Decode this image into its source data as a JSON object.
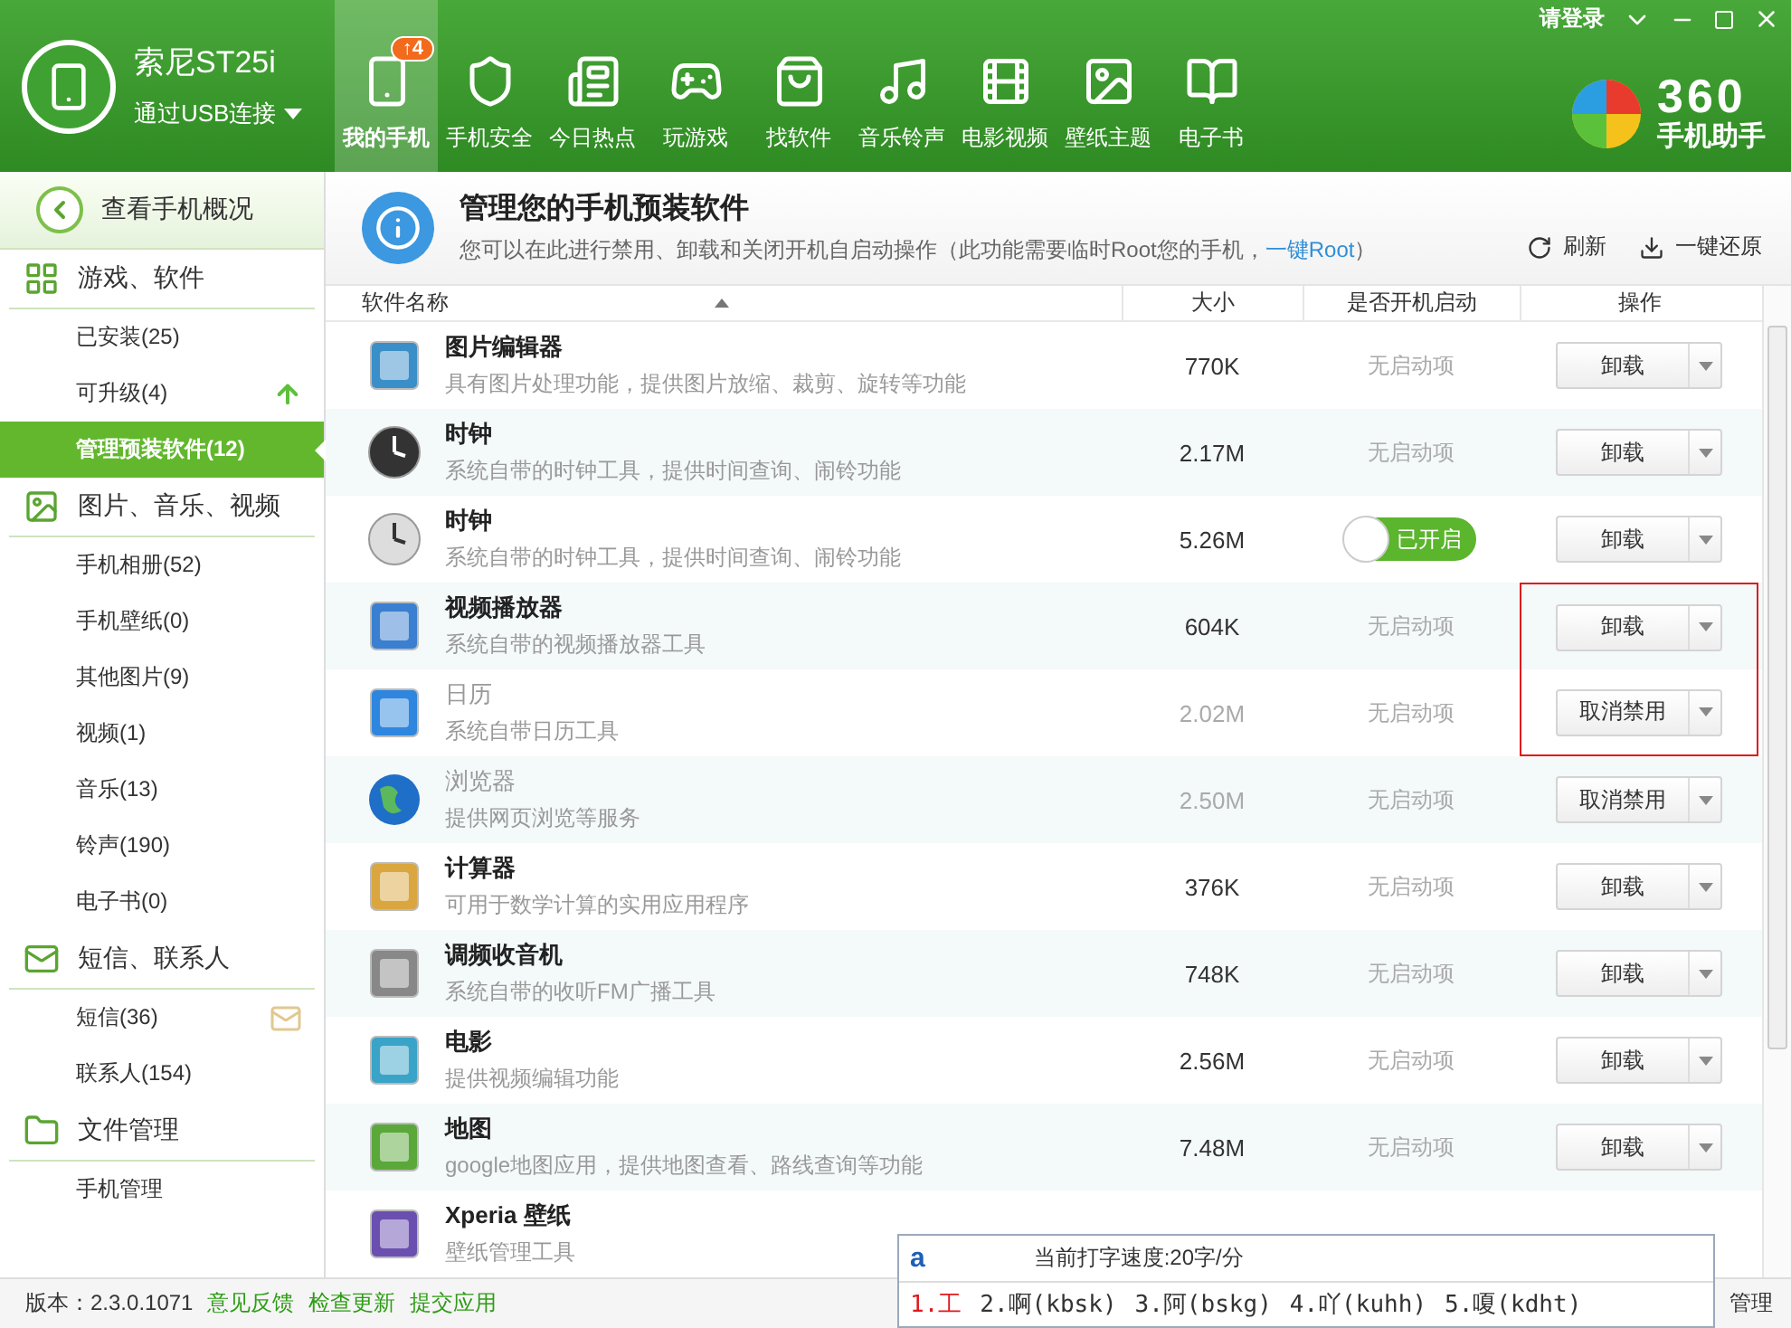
{
  "device": {
    "name": "索尼ST25i",
    "connection": "通过USB连接"
  },
  "nav": [
    {
      "label": "我的手机",
      "selected": true,
      "badge": "↑4"
    },
    {
      "label": "手机安全",
      "selected": false
    },
    {
      "label": "今日热点",
      "selected": false
    },
    {
      "label": "玩游戏",
      "selected": false
    },
    {
      "label": "找软件",
      "selected": false
    },
    {
      "label": "音乐铃声",
      "selected": false
    },
    {
      "label": "电影视频",
      "selected": false
    },
    {
      "label": "壁纸主题",
      "selected": false
    },
    {
      "label": "电子书",
      "selected": false
    }
  ],
  "window_controls": {
    "login": "请登录"
  },
  "logo": {
    "number": "360",
    "subtitle": "手机助手"
  },
  "sidebar": {
    "back": "查看手机概况",
    "groups": [
      {
        "title": "游戏、软件",
        "kind": "apps",
        "items": [
          {
            "label": "已安装(25)",
            "selected": false
          },
          {
            "label": "可升级(4)",
            "selected": false,
            "kind": "upgrade"
          },
          {
            "label": "管理预装软件(12)",
            "selected": true
          }
        ]
      },
      {
        "title": "图片、音乐、视频",
        "kind": "media",
        "items": [
          {
            "label": "手机相册(52)",
            "selected": false
          },
          {
            "label": "手机壁纸(0)",
            "selected": false
          },
          {
            "label": "其他图片(9)",
            "selected": false
          },
          {
            "label": "视频(1)",
            "selected": false
          },
          {
            "label": "音乐(13)",
            "selected": false
          },
          {
            "label": "铃声(190)",
            "selected": false
          },
          {
            "label": "电子书(0)",
            "selected": false
          }
        ]
      },
      {
        "title": "短信、联系人",
        "kind": "messages",
        "items": [
          {
            "label": "短信(36)",
            "selected": false,
            "kind": "mail"
          },
          {
            "label": "联系人(154)",
            "selected": false
          }
        ]
      },
      {
        "title": "文件管理",
        "kind": "files",
        "items": [
          {
            "label": "手机管理",
            "selected": false
          }
        ]
      }
    ]
  },
  "header": {
    "title": "管理您的手机预装软件",
    "description_before": "您可以在此进行禁用、卸载和关闭开机自启动操作（此功能需要临时Root您的手机，",
    "link": "一键Root",
    "description_after": "）",
    "actions": [
      "刷新",
      "一键还原"
    ]
  },
  "table": {
    "columns": [
      "软件名称",
      "大小",
      "是否开机启动",
      "操作"
    ],
    "rows": [
      {
        "name": "图片编辑器",
        "description": "具有图片处理功能，提供图片放缩、裁剪、旋转等功能",
        "size": "770K",
        "startup": {
          "kind": "none",
          "text": "无启动项"
        },
        "action": "卸载",
        "disabled": false,
        "highlighted": false
      },
      {
        "name": "时钟",
        "description": "系统自带的时钟工具，提供时间查询、闹铃功能",
        "size": "2.17M",
        "startup": {
          "kind": "none",
          "text": "无启动项"
        },
        "action": "卸载",
        "disabled": false,
        "highlighted": false
      },
      {
        "name": "时钟",
        "description": "系统自带的时钟工具，提供时间查询、闹铃功能",
        "size": "5.26M",
        "startup": {
          "kind": "toggle",
          "text": "已开启",
          "on": true
        },
        "action": "卸载",
        "disabled": false,
        "highlighted": false
      },
      {
        "name": "视频播放器",
        "description": "系统自带的视频播放器工具",
        "size": "604K",
        "startup": {
          "kind": "none",
          "text": "无启动项"
        },
        "action": "卸载",
        "disabled": false,
        "highlighted": true
      },
      {
        "name": "日历",
        "description": "系统自带日历工具",
        "size": "2.02M",
        "startup": {
          "kind": "none",
          "text": "无启动项"
        },
        "action": "取消禁用",
        "disabled": true,
        "highlighted": true
      },
      {
        "name": "浏览器",
        "description": "提供网页浏览等服务",
        "size": "2.50M",
        "startup": {
          "kind": "none",
          "text": "无启动项"
        },
        "action": "取消禁用",
        "disabled": true,
        "highlighted": false
      },
      {
        "name": "计算器",
        "description": "可用于数学计算的实用应用程序",
        "size": "376K",
        "startup": {
          "kind": "none",
          "text": "无启动项"
        },
        "action": "卸载",
        "disabled": false,
        "highlighted": false
      },
      {
        "name": "调频收音机",
        "description": "系统自带的收听FM广播工具",
        "size": "748K",
        "startup": {
          "kind": "none",
          "text": "无启动项"
        },
        "action": "卸载",
        "disabled": false,
        "highlighted": false
      },
      {
        "name": "电影",
        "description": "提供视频编辑功能",
        "size": "2.56M",
        "startup": {
          "kind": "none",
          "text": "无启动项"
        },
        "action": "卸载",
        "disabled": false,
        "highlighted": false
      },
      {
        "name": "地图",
        "description": "google地图应用，提供地图查看、路线查询等功能",
        "size": "7.48M",
        "startup": {
          "kind": "none",
          "text": "无启动项"
        },
        "action": "卸载",
        "disabled": false,
        "highlighted": false
      },
      {
        "name": "Xperia 壁纸",
        "description": "壁纸管理工具",
        "disabled": false,
        "highlighted": false
      }
    ]
  },
  "status_bar": {
    "version": "版本：2.3.0.1071",
    "links": [
      "意见反馈",
      "检查更新",
      "提交应用"
    ],
    "right": "管理"
  },
  "ime": {
    "input": "a",
    "speed": "当前打字速度:20字/分",
    "candidates": [
      {
        "text": "1.工",
        "selected": true
      },
      {
        "text": "2.啊(kbsk)",
        "selected": false
      },
      {
        "text": "3.阿(bskg)",
        "selected": false
      },
      {
        "text": "4.吖(kuhh)",
        "selected": false
      },
      {
        "text": "5.嗄(kdht)",
        "selected": false
      }
    ]
  }
}
